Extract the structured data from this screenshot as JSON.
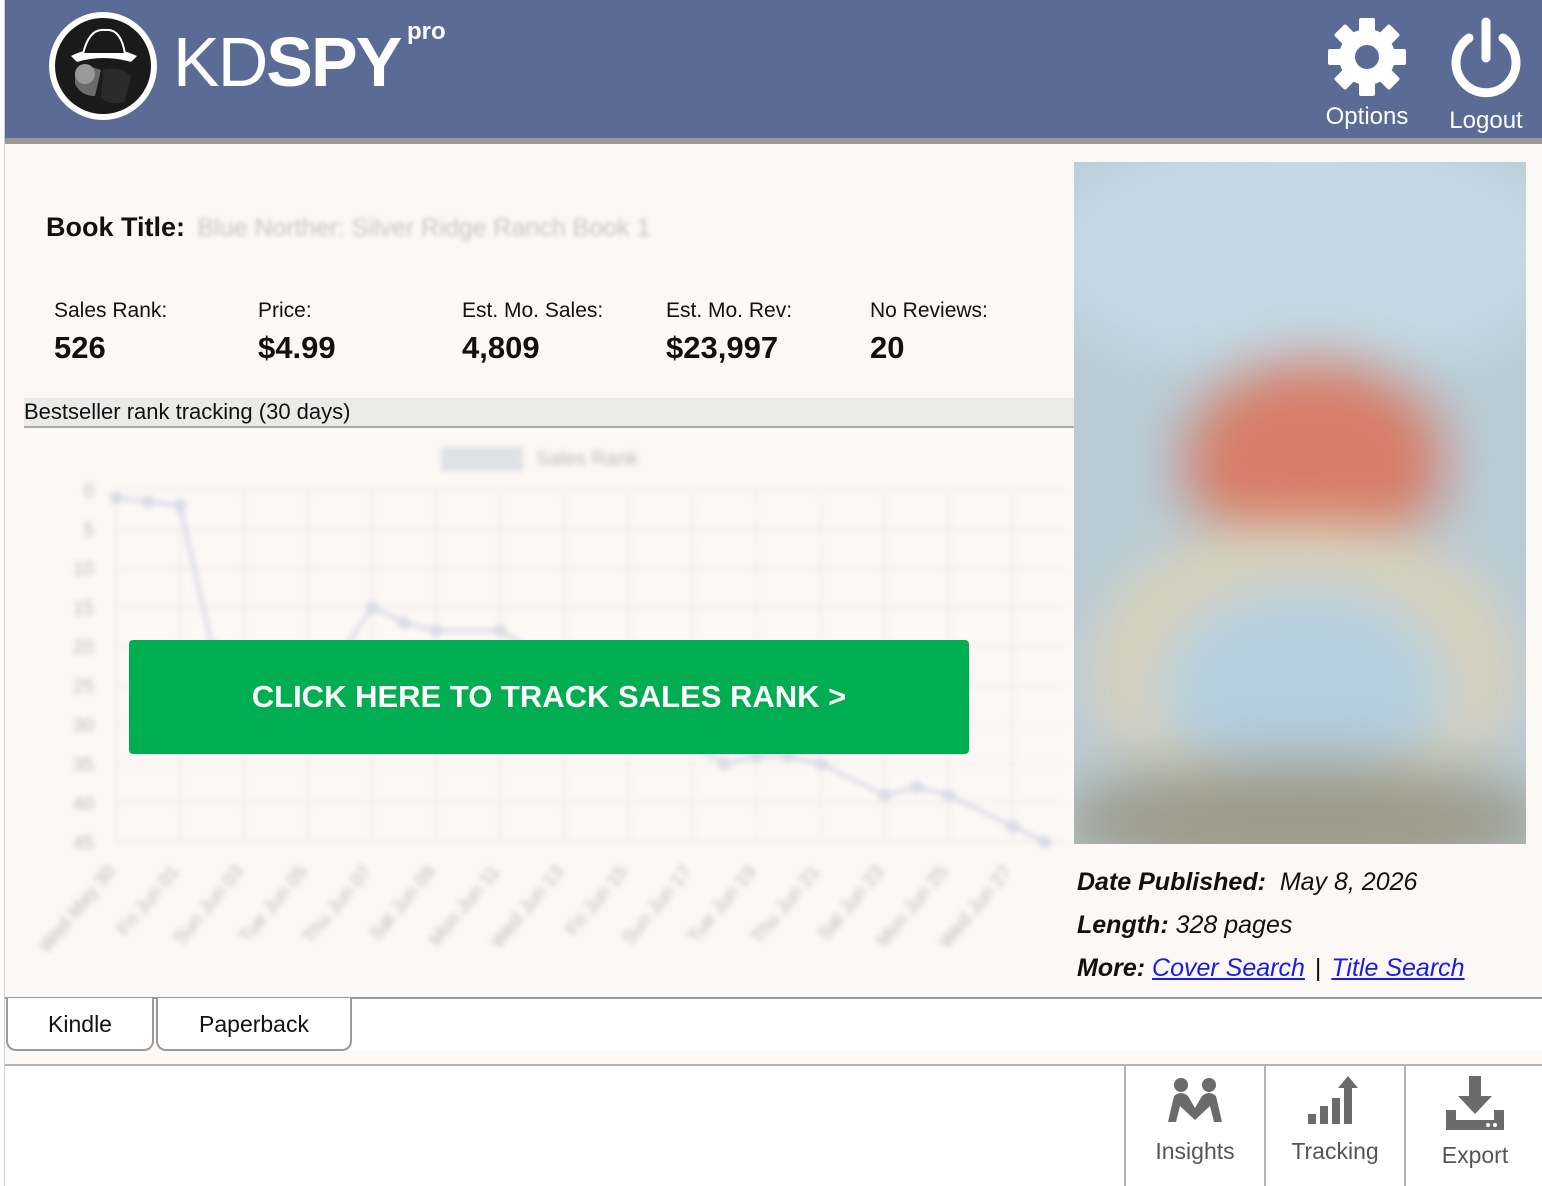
{
  "header": {
    "brand_kd": "KD",
    "brand_spy": "SPY",
    "brand_pro": "pro",
    "options_label": "Options",
    "logout_label": "Logout",
    "background_color": "#5a6c95"
  },
  "book": {
    "title_label": "Book Title:",
    "title_value": "Blue Norther: Silver Ridge Ranch Book 1"
  },
  "stats": [
    {
      "label": "Sales Rank:",
      "value": "526"
    },
    {
      "label": "Price:",
      "value": "$4.99"
    },
    {
      "label": "Est. Mo. Sales:",
      "value": "4,809"
    },
    {
      "label": "Est. Mo. Rev:",
      "value": "$23,997"
    },
    {
      "label": "No Reviews:",
      "value": "20"
    }
  ],
  "tracking": {
    "section_title": "Bestseller rank tracking (30 days)",
    "cta_label": "CLICK HERE TO TRACK SALES RANK >",
    "cta_color": "#00ad50"
  },
  "chart_data": {
    "type": "line",
    "legend": "Sales Rank",
    "legend_position": "top-center",
    "yticks": [
      "0",
      "5",
      "10",
      "15",
      "20",
      "25",
      "30",
      "35",
      "40",
      "45"
    ],
    "ylim": [
      0,
      45
    ],
    "y_inverted": true,
    "grid": true,
    "categories": [
      "Wed May 30",
      "Fri Jun 01",
      "Sun Jun 03",
      "Tue Jun 05",
      "Thu Jun 07",
      "Sat Jun 09",
      "Mon Jun 11",
      "Wed Jun 13",
      "Fri Jun 15",
      "Sun Jun 17",
      "Tue Jun 19",
      "Thu Jun 21",
      "Sat Jun 23",
      "Mon Jun 25",
      "Wed Jun 27"
    ],
    "series": [
      {
        "name": "Sales Rank",
        "x_index": [
          0,
          0.5,
          1,
          1.5,
          2,
          3,
          3.5,
          4,
          4.5,
          5,
          6,
          9.5,
          10,
          10.5,
          11,
          12,
          12.5,
          13,
          14,
          14.5
        ],
        "values": [
          1,
          1.5,
          2,
          20,
          22,
          22,
          21,
          15,
          17,
          18,
          18,
          35,
          34,
          34,
          35,
          39,
          38,
          39,
          43,
          45
        ]
      }
    ],
    "color": "#c8cfe0"
  },
  "details": {
    "date_label": "Date Published:",
    "date_value": "May 8, 2026",
    "length_label": "Length:",
    "length_value": "328 pages",
    "more_label": "More:",
    "cover_search": "Cover Search",
    "separator": "|",
    "title_search": "Title Search"
  },
  "tabs": [
    {
      "label": "Kindle",
      "active": true
    },
    {
      "label": "Paperback",
      "active": false
    }
  ],
  "toolbar": {
    "insights": "Insights",
    "tracking": "Tracking",
    "export": "Export"
  }
}
